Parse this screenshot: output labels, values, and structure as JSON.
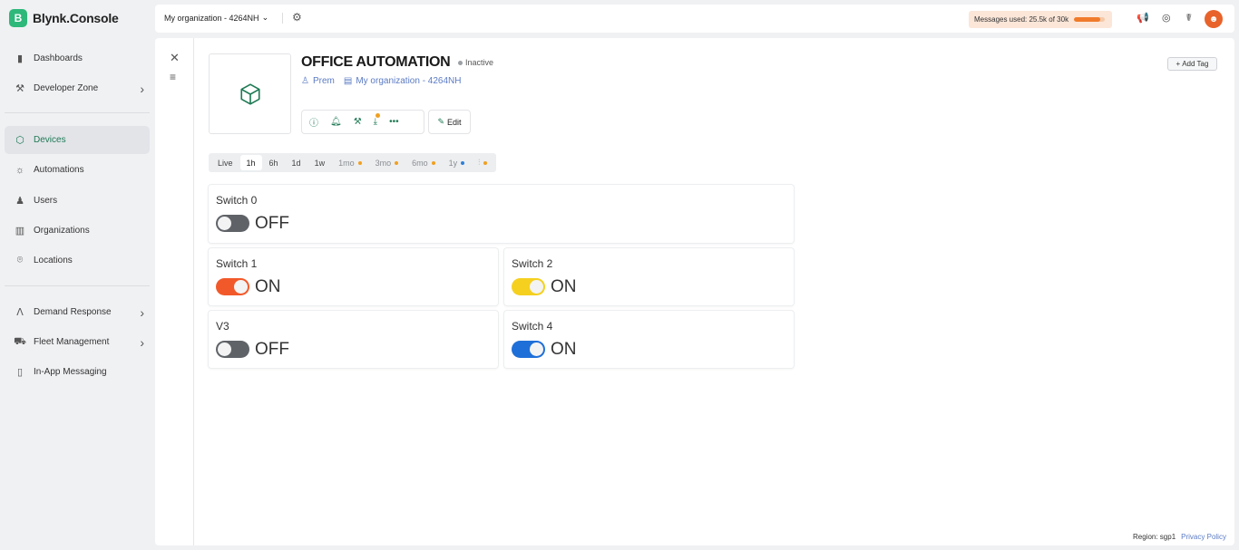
{
  "app": {
    "logo_letter": "B",
    "title": "Blynk.Console"
  },
  "sidebar": {
    "items": [
      {
        "label": "Dashboards",
        "icon": "bar-chart-icon"
      },
      {
        "label": "Developer Zone",
        "icon": "tools-icon"
      },
      {
        "label": "Devices",
        "icon": "cube-icon"
      },
      {
        "label": "Automations",
        "icon": "sun-icon"
      },
      {
        "label": "Users",
        "icon": "user-icon"
      },
      {
        "label": "Organizations",
        "icon": "building-icon"
      },
      {
        "label": "Locations",
        "icon": "pin-icon"
      },
      {
        "label": "Demand Response",
        "icon": "signal-icon"
      },
      {
        "label": "Fleet Management",
        "icon": "truck-icon"
      },
      {
        "label": "In-App Messaging",
        "icon": "message-icon"
      }
    ],
    "active": "Devices"
  },
  "topbar": {
    "org_name": "My organization - 4264NH",
    "messages_label": "Messages used: 25.5k of 30k",
    "messages_fraction": 0.85
  },
  "device": {
    "name": "OFFICE AUTOMATION",
    "status": "Inactive",
    "owner": "Prem",
    "organization": "My organization - 4264NH",
    "edit_label": "Edit",
    "add_tag_label": "Add Tag"
  },
  "time_tabs": [
    {
      "label": "Live"
    },
    {
      "label": "1h",
      "active": true
    },
    {
      "label": "6h"
    },
    {
      "label": "1d"
    },
    {
      "label": "1w"
    },
    {
      "label": "1mo",
      "dot": "#f0a020"
    },
    {
      "label": "3mo",
      "dot": "#f0a020"
    },
    {
      "label": "6mo",
      "dot": "#f0a020"
    },
    {
      "label": "1y",
      "dot": "#2f7fd6"
    },
    {
      "label": "",
      "dot": "#f0a020"
    }
  ],
  "widgets": [
    {
      "label": "Switch 0",
      "state": "OFF",
      "on": false,
      "color": "#5f6368"
    },
    {
      "label": "Switch 1",
      "state": "ON",
      "on": true,
      "color": "#f2592a"
    },
    {
      "label": "Switch 2",
      "state": "ON",
      "on": true,
      "color": "#f5d01f"
    },
    {
      "label": "V3",
      "state": "OFF",
      "on": false,
      "color": "#5f6368"
    },
    {
      "label": "Switch 4",
      "state": "ON",
      "on": true,
      "color": "#1f6fd8"
    }
  ],
  "footer": {
    "region": "Region: sgp1",
    "privacy": "Privacy Policy"
  },
  "colors": {
    "brand": "#2eb87a",
    "accent": "#1f7a55",
    "link": "#5b7bc4"
  }
}
